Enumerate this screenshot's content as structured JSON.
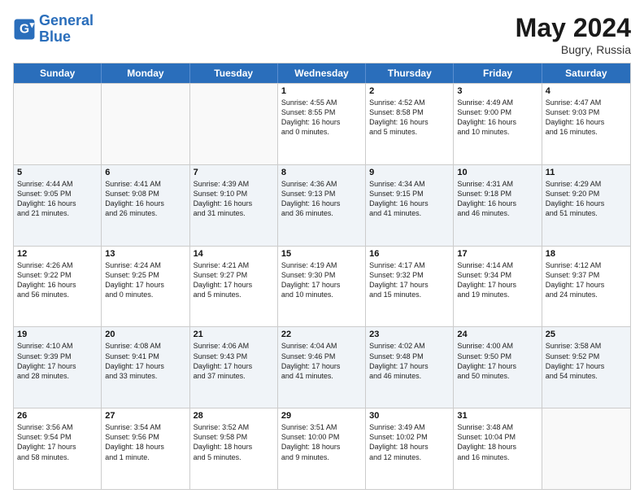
{
  "header": {
    "logo_line1": "General",
    "logo_line2": "Blue",
    "month_year": "May 2024",
    "location": "Bugry, Russia"
  },
  "days_of_week": [
    "Sunday",
    "Monday",
    "Tuesday",
    "Wednesday",
    "Thursday",
    "Friday",
    "Saturday"
  ],
  "weeks": [
    [
      {
        "day": "",
        "detail": ""
      },
      {
        "day": "",
        "detail": ""
      },
      {
        "day": "",
        "detail": ""
      },
      {
        "day": "1",
        "detail": "Sunrise: 4:55 AM\nSunset: 8:55 PM\nDaylight: 16 hours\nand 0 minutes."
      },
      {
        "day": "2",
        "detail": "Sunrise: 4:52 AM\nSunset: 8:58 PM\nDaylight: 16 hours\nand 5 minutes."
      },
      {
        "day": "3",
        "detail": "Sunrise: 4:49 AM\nSunset: 9:00 PM\nDaylight: 16 hours\nand 10 minutes."
      },
      {
        "day": "4",
        "detail": "Sunrise: 4:47 AM\nSunset: 9:03 PM\nDaylight: 16 hours\nand 16 minutes."
      }
    ],
    [
      {
        "day": "5",
        "detail": "Sunrise: 4:44 AM\nSunset: 9:05 PM\nDaylight: 16 hours\nand 21 minutes."
      },
      {
        "day": "6",
        "detail": "Sunrise: 4:41 AM\nSunset: 9:08 PM\nDaylight: 16 hours\nand 26 minutes."
      },
      {
        "day": "7",
        "detail": "Sunrise: 4:39 AM\nSunset: 9:10 PM\nDaylight: 16 hours\nand 31 minutes."
      },
      {
        "day": "8",
        "detail": "Sunrise: 4:36 AM\nSunset: 9:13 PM\nDaylight: 16 hours\nand 36 minutes."
      },
      {
        "day": "9",
        "detail": "Sunrise: 4:34 AM\nSunset: 9:15 PM\nDaylight: 16 hours\nand 41 minutes."
      },
      {
        "day": "10",
        "detail": "Sunrise: 4:31 AM\nSunset: 9:18 PM\nDaylight: 16 hours\nand 46 minutes."
      },
      {
        "day": "11",
        "detail": "Sunrise: 4:29 AM\nSunset: 9:20 PM\nDaylight: 16 hours\nand 51 minutes."
      }
    ],
    [
      {
        "day": "12",
        "detail": "Sunrise: 4:26 AM\nSunset: 9:22 PM\nDaylight: 16 hours\nand 56 minutes."
      },
      {
        "day": "13",
        "detail": "Sunrise: 4:24 AM\nSunset: 9:25 PM\nDaylight: 17 hours\nand 0 minutes."
      },
      {
        "day": "14",
        "detail": "Sunrise: 4:21 AM\nSunset: 9:27 PM\nDaylight: 17 hours\nand 5 minutes."
      },
      {
        "day": "15",
        "detail": "Sunrise: 4:19 AM\nSunset: 9:30 PM\nDaylight: 17 hours\nand 10 minutes."
      },
      {
        "day": "16",
        "detail": "Sunrise: 4:17 AM\nSunset: 9:32 PM\nDaylight: 17 hours\nand 15 minutes."
      },
      {
        "day": "17",
        "detail": "Sunrise: 4:14 AM\nSunset: 9:34 PM\nDaylight: 17 hours\nand 19 minutes."
      },
      {
        "day": "18",
        "detail": "Sunrise: 4:12 AM\nSunset: 9:37 PM\nDaylight: 17 hours\nand 24 minutes."
      }
    ],
    [
      {
        "day": "19",
        "detail": "Sunrise: 4:10 AM\nSunset: 9:39 PM\nDaylight: 17 hours\nand 28 minutes."
      },
      {
        "day": "20",
        "detail": "Sunrise: 4:08 AM\nSunset: 9:41 PM\nDaylight: 17 hours\nand 33 minutes."
      },
      {
        "day": "21",
        "detail": "Sunrise: 4:06 AM\nSunset: 9:43 PM\nDaylight: 17 hours\nand 37 minutes."
      },
      {
        "day": "22",
        "detail": "Sunrise: 4:04 AM\nSunset: 9:46 PM\nDaylight: 17 hours\nand 41 minutes."
      },
      {
        "day": "23",
        "detail": "Sunrise: 4:02 AM\nSunset: 9:48 PM\nDaylight: 17 hours\nand 46 minutes."
      },
      {
        "day": "24",
        "detail": "Sunrise: 4:00 AM\nSunset: 9:50 PM\nDaylight: 17 hours\nand 50 minutes."
      },
      {
        "day": "25",
        "detail": "Sunrise: 3:58 AM\nSunset: 9:52 PM\nDaylight: 17 hours\nand 54 minutes."
      }
    ],
    [
      {
        "day": "26",
        "detail": "Sunrise: 3:56 AM\nSunset: 9:54 PM\nDaylight: 17 hours\nand 58 minutes."
      },
      {
        "day": "27",
        "detail": "Sunrise: 3:54 AM\nSunset: 9:56 PM\nDaylight: 18 hours\nand 1 minute."
      },
      {
        "day": "28",
        "detail": "Sunrise: 3:52 AM\nSunset: 9:58 PM\nDaylight: 18 hours\nand 5 minutes."
      },
      {
        "day": "29",
        "detail": "Sunrise: 3:51 AM\nSunset: 10:00 PM\nDaylight: 18 hours\nand 9 minutes."
      },
      {
        "day": "30",
        "detail": "Sunrise: 3:49 AM\nSunset: 10:02 PM\nDaylight: 18 hours\nand 12 minutes."
      },
      {
        "day": "31",
        "detail": "Sunrise: 3:48 AM\nSunset: 10:04 PM\nDaylight: 18 hours\nand 16 minutes."
      },
      {
        "day": "",
        "detail": ""
      }
    ]
  ]
}
